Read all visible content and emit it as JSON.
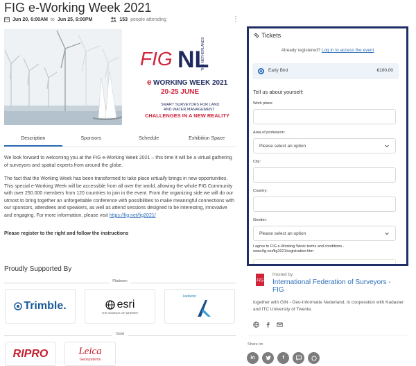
{
  "event": {
    "title": "FIG e-Working Week 2021",
    "date_start": "Jun 20, 6:00AM",
    "date_to": "to",
    "date_end": "Jun 25, 6:00PM",
    "attendees_count": "153",
    "attendees_label": "people attending"
  },
  "banner": {
    "logo_left": "FIG",
    "logo_right": "NL",
    "logo_sub": "THE NETHERLANDS",
    "eweek_e": "e",
    "eweek_title": "WORKING WEEK 2021",
    "eweek_dates": "20-25 JUNE",
    "tagline_1": "SMART SURVEYORS FOR LAND",
    "tagline_2": "AND WATER MANAGEMENT",
    "tagline_3": "CHALLENGES IN A NEW REALITY"
  },
  "tabs": [
    {
      "label": "Description"
    },
    {
      "label": "Sponsors"
    },
    {
      "label": "Schedule"
    },
    {
      "label": "Exhibition Space"
    }
  ],
  "description": {
    "p1": "We look forward to welcoming you at the FIG e-Working Week 2021 – this time it will be a virtual gathering of surveyors and spatial experts from around the globe.",
    "p2_before": "The fact that the Working Week has been transformed to take place ",
    "p2_italic": "virtually",
    "p2_after": " brings in new opportunities. This special e-Working Week will be accessible from all over the world, allowing the whole FIG Community with over 250.000 members from 120 countries to join in the event. From the organizing side we will do our utmost to bring together an unforgettable conference with possibilities to make meaningful connections with our sponsors, attendees and speakers, as well as attend sessions designed to be interesting, innovative and engaging. For more information, please visit ",
    "p2_link": "https://fig.net/fig2021/",
    "register_note": "Please register to the right and follow the instructions"
  },
  "sponsors": {
    "heading": "Proudly Supported By",
    "tier_platinum": "Platinum",
    "tier_gold": "Gold",
    "trimble": "Trimble.",
    "esri": "esri",
    "esri_tag": "THE SCIENCE OF WHERE®",
    "kadaster": "kadaster",
    "ripro": "RIPRO",
    "leica_1": "Leica",
    "leica_2": "Geosystems"
  },
  "tickets": {
    "title": "Tickets",
    "already": "Already registered?",
    "login_link": "Log in to access the event",
    "ticket_name": "Early Bird",
    "ticket_price": "€100.00",
    "form_heading": "Tell us about yourself:",
    "work_place_label": "Work place:",
    "area_label": "Area of profession:",
    "area_placeholder": "Please select an option",
    "city_label": "City:",
    "country_label": "Country:",
    "gender_label": "Gender:",
    "gender_placeholder": "Please select an option",
    "terms": "I agree to FIG e-Working Week terms and conditions - www.fig.net/fig2021/registration.htm"
  },
  "host": {
    "hosted_by": "Hosted by",
    "name": "International Federation of Surveyors - FIG",
    "description": "together with GIN - Geo-Informatie Nederland, in cooperation with Kadaster and ITC University of Twente.",
    "share_label": "Share on"
  },
  "colors": {
    "accent": "#2e6fb8",
    "panel_border": "#1f2f66",
    "fig_red": "#d1243b",
    "nl_navy": "#1e2a5e"
  }
}
